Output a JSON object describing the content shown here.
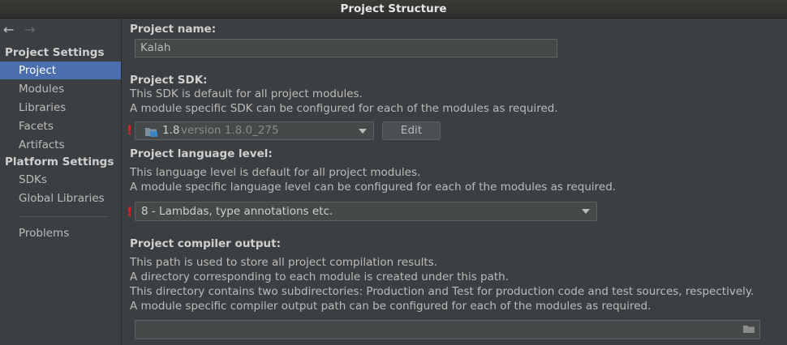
{
  "window": {
    "title": "Project Structure"
  },
  "sidebar": {
    "project_settings_header": "Project Settings",
    "project_items": [
      {
        "label": "Project",
        "selected": true
      },
      {
        "label": "Modules"
      },
      {
        "label": "Libraries"
      },
      {
        "label": "Facets"
      },
      {
        "label": "Artifacts"
      }
    ],
    "platform_settings_header": "Platform Settings",
    "platform_items": [
      {
        "label": "SDKs"
      },
      {
        "label": "Global Libraries"
      }
    ],
    "problems_label": "Problems"
  },
  "project_name": {
    "label": "Project name:",
    "value": "Kalah"
  },
  "project_sdk": {
    "label": "Project SDK:",
    "desc1": "This SDK is default for all project modules.",
    "desc2": "A module specific SDK can be configured for each of the modules as required.",
    "selected_name": "1.8",
    "selected_version": "version 1.8.0_275",
    "edit_label": "Edit",
    "warning": "!"
  },
  "language_level": {
    "label": "Project language level:",
    "desc1": "This language level is default for all project modules.",
    "desc2": "A module specific language level can be configured for each of the modules as required.",
    "selected": "8 - Lambdas, type annotations etc.",
    "warning": "!"
  },
  "compiler_output": {
    "label": "Project compiler output:",
    "desc1": "This path is used to store all project compilation results.",
    "desc2": "A directory corresponding to each module is created under this path.",
    "desc3": "This directory contains two subdirectories: Production and Test for production code and test sources, respectively.",
    "desc4": "A module specific compiler output path can be configured for each of the modules as required.",
    "value": ""
  },
  "colors": {
    "selection": "#4b6eaf",
    "warning": "#e0211f",
    "background": "#3c3f41"
  }
}
